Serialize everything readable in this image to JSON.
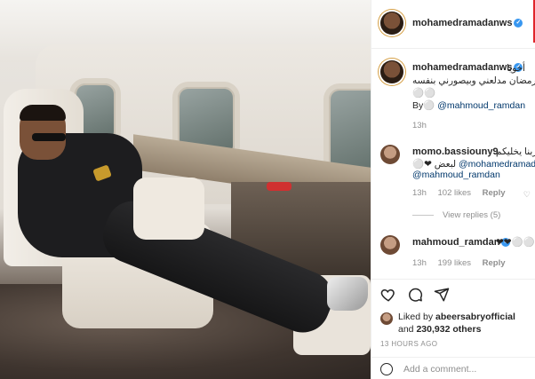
{
  "post": {
    "author": "mohamedramadanws",
    "caption": {
      "line1": "أخويا",
      "line2": "محمود رمضان مدلعني وبيصورني بنفسه",
      "line3": "⚪⚪",
      "by_prefix": "By⚪",
      "by_mention": "@mahmoud_ramdan",
      "time": "13h"
    },
    "comments": [
      {
        "user": "momo.bassiouny9",
        "text_rtl": "ربنا يخليكم",
        "mention1": "@mohamedramadan",
        "text2_rtl": "⚪❤ لبعض",
        "mention2": "@mahmoud_ramdan",
        "time": "13h",
        "likes": "102 likes",
        "reply": "Reply",
        "view_replies": "View replies (5)"
      },
      {
        "user": "mahmoud_ramdan",
        "text": "❤❤⚪⚪⚪",
        "time": "13h",
        "likes": "199 likes",
        "reply": "Reply"
      }
    ],
    "liked_by": {
      "prefix": "Liked by",
      "user": "abeersabryofficial",
      "and": "and",
      "others": "230,932 others"
    },
    "time_ago": "13 HOURS AGO",
    "add_comment_placeholder": "Add a comment..."
  },
  "icons": {
    "like": "heart-icon",
    "comment": "comment-icon",
    "share": "share-icon",
    "emoji": "emoji-icon",
    "verified": "verified-badge-icon"
  },
  "colors": {
    "verified_blue": "#3897f0",
    "link": "#00376b",
    "muted": "#8e8e8e"
  }
}
